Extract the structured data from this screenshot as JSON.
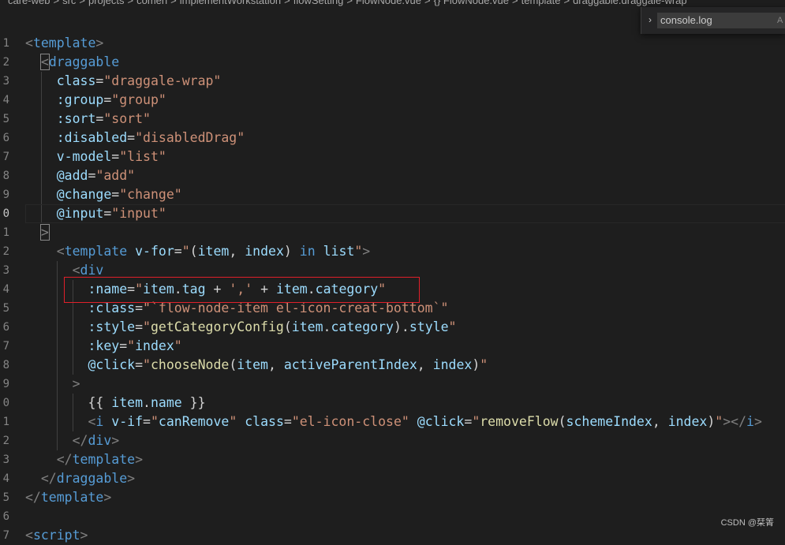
{
  "breadcrumb": {
    "items": [
      "care-web",
      "src",
      "projects",
      "comen",
      "implementWorkstation",
      "flowSetting",
      "FlowNode.vue",
      "{} FlowNode.vue",
      "template",
      "draggable.draggale-wrap"
    ],
    "separator": ">"
  },
  "find_widget": {
    "toggle_icon": "chevron-right-icon",
    "value": "console.log",
    "option_label": "A"
  },
  "gutter": {
    "numbers": [
      "1",
      "2",
      "3",
      "4",
      "5",
      "6",
      "7",
      "8",
      "9",
      "0",
      "1",
      "2",
      "3",
      "4",
      "5",
      "6",
      "7",
      "8",
      "9",
      "0",
      "1",
      "2",
      "3",
      "4",
      "5",
      "6",
      "7"
    ]
  },
  "code": {
    "l1": {
      "open": "<",
      "tag": "template",
      "close": ">"
    },
    "l2": {
      "open": "<",
      "tag": "draggable"
    },
    "l3": {
      "attr": "class",
      "eq": "=",
      "val": "\"draggale-wrap\""
    },
    "l4": {
      "attr": ":group",
      "eq": "=",
      "val": "\"group\""
    },
    "l5": {
      "attr": ":sort",
      "eq": "=",
      "val": "\"sort\""
    },
    "l6": {
      "attr": ":disabled",
      "eq": "=",
      "val": "\"disabledDrag\""
    },
    "l7": {
      "attr": "v-model",
      "eq": "=",
      "val": "\"list\""
    },
    "l8": {
      "attr": "@add",
      "eq": "=",
      "val": "\"add\""
    },
    "l9": {
      "attr": "@change",
      "eq": "=",
      "val": "\"change\""
    },
    "l10": {
      "attr": "@input",
      "eq": "=",
      "val": "\"input\""
    },
    "l11": {
      "close": ">"
    },
    "l12": {
      "open": "<",
      "tag": "template",
      "attr": "v-for",
      "eq": "=",
      "q1": "\"",
      "p1": "(",
      "v1": "item",
      ", ": ", ",
      "v2": "index",
      "p2": ")",
      "kw": "in",
      "v3": "list",
      "q2": "\"",
      "close": ">"
    },
    "l13": {
      "open": "<",
      "tag": "div"
    },
    "l14": {
      "attr": ":name",
      "eq": "=",
      "q1": "\"",
      "v1": "item",
      "d1": ".",
      "v2": "tag",
      "op1": " + ",
      "s1": "','",
      "op2": " + ",
      "v3": "item",
      "d2": ".",
      "v4": "category",
      "q2": "\""
    },
    "l15": {
      "attr": ":class",
      "eq": "=",
      "q1": "\"",
      "s1": "`flow-node-item el-icon-creat-bottom`",
      "q2": "\""
    },
    "l16": {
      "attr": ":style",
      "eq": "=",
      "q1": "\"",
      "fn": "getCategoryConfig",
      "p1": "(",
      "v1": "item",
      "d1": ".",
      "v2": "category",
      "p2": ")",
      "d2": ".",
      "v3": "style",
      "q2": "\""
    },
    "l17": {
      "attr": ":key",
      "eq": "=",
      "q1": "\"",
      "v1": "index",
      "q2": "\""
    },
    "l18": {
      "attr": "@click",
      "eq": "=",
      "q1": "\"",
      "fn": "chooseNode",
      "p1": "(",
      "v1": "item",
      ", 1": ", ",
      "v2": "activeParentIndex",
      ", 2": ", ",
      "v3": "index",
      "p2": ")",
      "q2": "\""
    },
    "l19": {
      "close": ">"
    },
    "l20": {
      "m1": "{{ ",
      "v1": "item",
      "d1": ".",
      "v2": "name",
      "m2": " }}"
    },
    "l21": {
      "open": "<",
      "tag": "i",
      "attr1": "v-if",
      "eq1": "=",
      "q1": "\"",
      "v1": "canRemove",
      "q2": "\"",
      "attr2": "class",
      "eq2": "=",
      "val2": "\"el-icon-close\"",
      "attr3": "@click",
      "eq3": "=",
      "q3": "\"",
      "fn": "removeFlow",
      "p1": "(",
      "v2": "schemeIndex",
      ", ": ", ",
      "v3": "index",
      "p2": ")",
      "q4": "\"",
      "end": "></",
      "tag2": "i",
      "close": ">"
    },
    "l22": {
      "open": "</",
      "tag": "div",
      "close": ">"
    },
    "l23": {
      "open": "</",
      "tag": "template",
      "close": ">"
    },
    "l24": {
      "open": "</",
      "tag": "draggable",
      "close": ">"
    },
    "l25": {
      "open": "</",
      "tag": "template",
      "close": ">"
    },
    "l27": {
      "open": "<",
      "tag": "script",
      "close": ">"
    }
  },
  "watermark": "CSDN @栞箐"
}
